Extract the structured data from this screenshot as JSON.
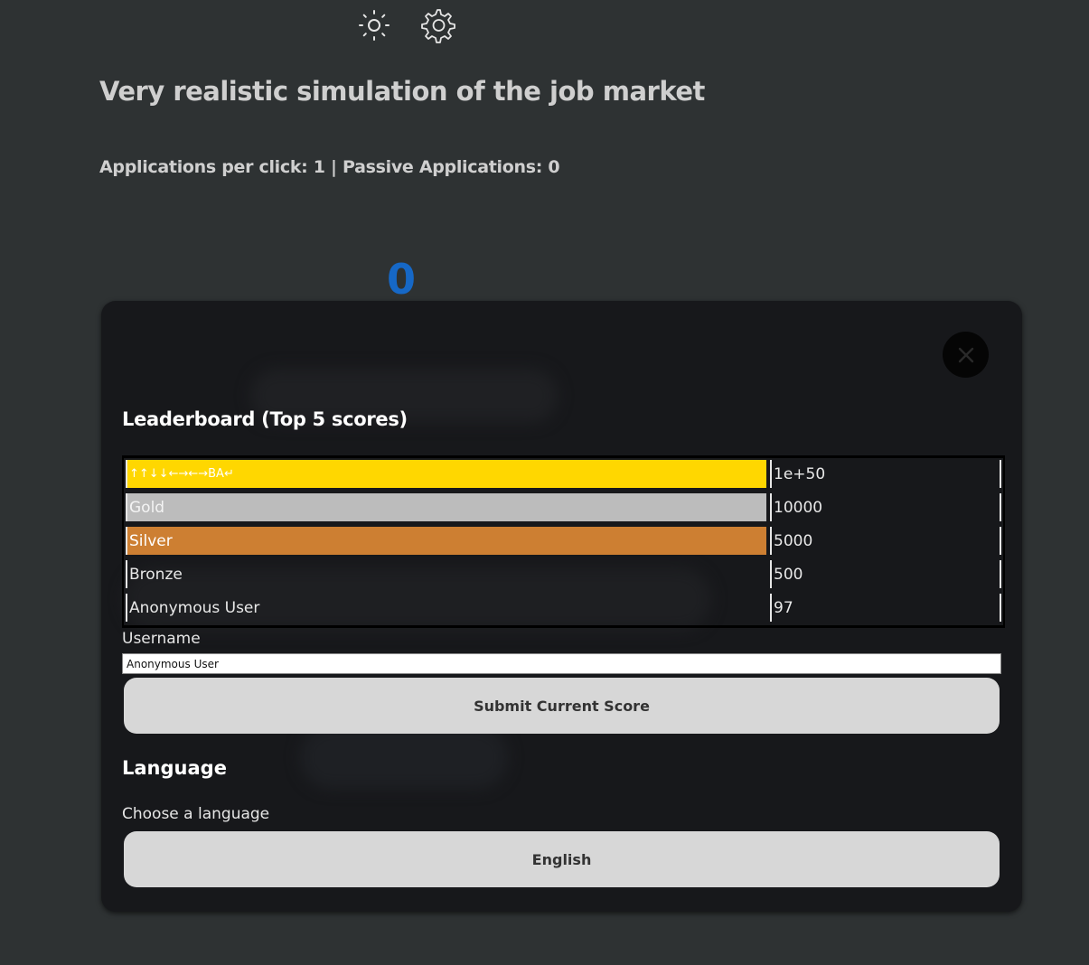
{
  "header": {
    "brightness_icon": "sun-icon",
    "settings_icon": "gear-icon"
  },
  "page": {
    "title": "Very realistic simulation of the job market",
    "stats": "Applications per click: 1 | Passive Applications: 0",
    "counter": "0"
  },
  "modal": {
    "close_icon": "close-icon",
    "leaderboard_title": "Leaderboard (Top 5 scores)",
    "leaderboard": [
      {
        "name": "↑↑↓↓←→←→BA↵",
        "score": "1e+50",
        "bg": "#ffd700",
        "color": "#ffffff"
      },
      {
        "name": "Gold",
        "score": "10000",
        "bg": "#bcbcbc",
        "color": "#f4f4f4"
      },
      {
        "name": "Silver",
        "score": "5000",
        "bg": "#cd7f32",
        "color": "#ffffff"
      },
      {
        "name": "Bronze",
        "score": "500",
        "bg": "",
        "color": "#e8e8e8"
      },
      {
        "name": "Anonymous User",
        "score": "97",
        "bg": "",
        "color": "#e8e8e8"
      }
    ],
    "username_label": "Username",
    "username_value": "Anonymous User",
    "submit_label": "Submit Current Score",
    "language_title": "Language",
    "choose_language_label": "Choose a language",
    "language_value": "English"
  },
  "colors": {
    "background": "#2e3233",
    "modal": "#17181b",
    "counter": "#1668c7",
    "button": "#d7d7d7"
  }
}
